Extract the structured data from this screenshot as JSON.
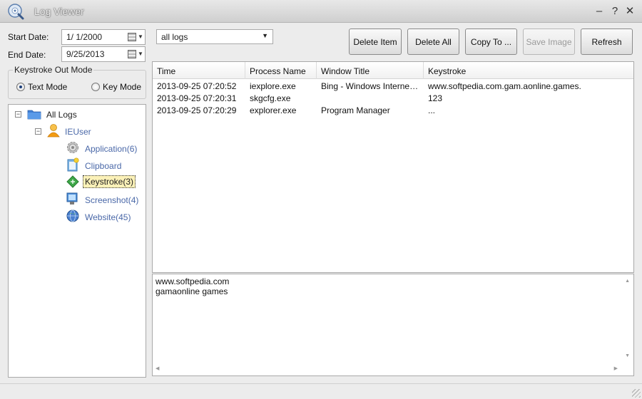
{
  "window": {
    "title": "Log Viewer",
    "minimize": "–",
    "help": "?",
    "close": "✕"
  },
  "filters": {
    "start_label": "Start Date:",
    "start_value": "1/  1/2000",
    "end_label": "End Date:",
    "end_value": "9/25/2013",
    "log_filter": "all logs"
  },
  "toolbar": {
    "delete_item": "Delete Item",
    "delete_all": "Delete All",
    "copy_to": "Copy To ...",
    "save_image": "Save Image",
    "refresh": "Refresh"
  },
  "keystroke_mode": {
    "title": "Keystroke Out Mode",
    "text_mode": "Text Mode",
    "key_mode": "Key Mode"
  },
  "tree": {
    "root": "All Logs",
    "user": "IEUser",
    "items": [
      {
        "label": "Application(6)",
        "icon": "gear-icon"
      },
      {
        "label": "Clipboard",
        "icon": "clipboard-icon"
      },
      {
        "label": "Keystroke(3)",
        "icon": "keyboard-icon"
      },
      {
        "label": "Screenshot(4)",
        "icon": "monitor-icon"
      },
      {
        "label": "Website(45)",
        "icon": "globe-icon"
      }
    ]
  },
  "table": {
    "columns": [
      "Time",
      "Process Name",
      "Window Title",
      "Keystroke"
    ],
    "rows": [
      [
        "2013-09-25 07:20:52",
        "iexplore.exe",
        "Bing - Windows Internet E...",
        "www.softpedia.com.gam.aonline.games."
      ],
      [
        "2013-09-25 07:20:31",
        "skgcfg.exe",
        "",
        "123"
      ],
      [
        "2013-09-25 07:20:29",
        "explorer.exe",
        "Program Manager",
        "..."
      ]
    ]
  },
  "detail": {
    "lines": [
      "www.softpedia.com",
      "gamaonline games"
    ]
  },
  "colors": {
    "accent": "#4a68a8",
    "selection": "#fbf1b8"
  }
}
